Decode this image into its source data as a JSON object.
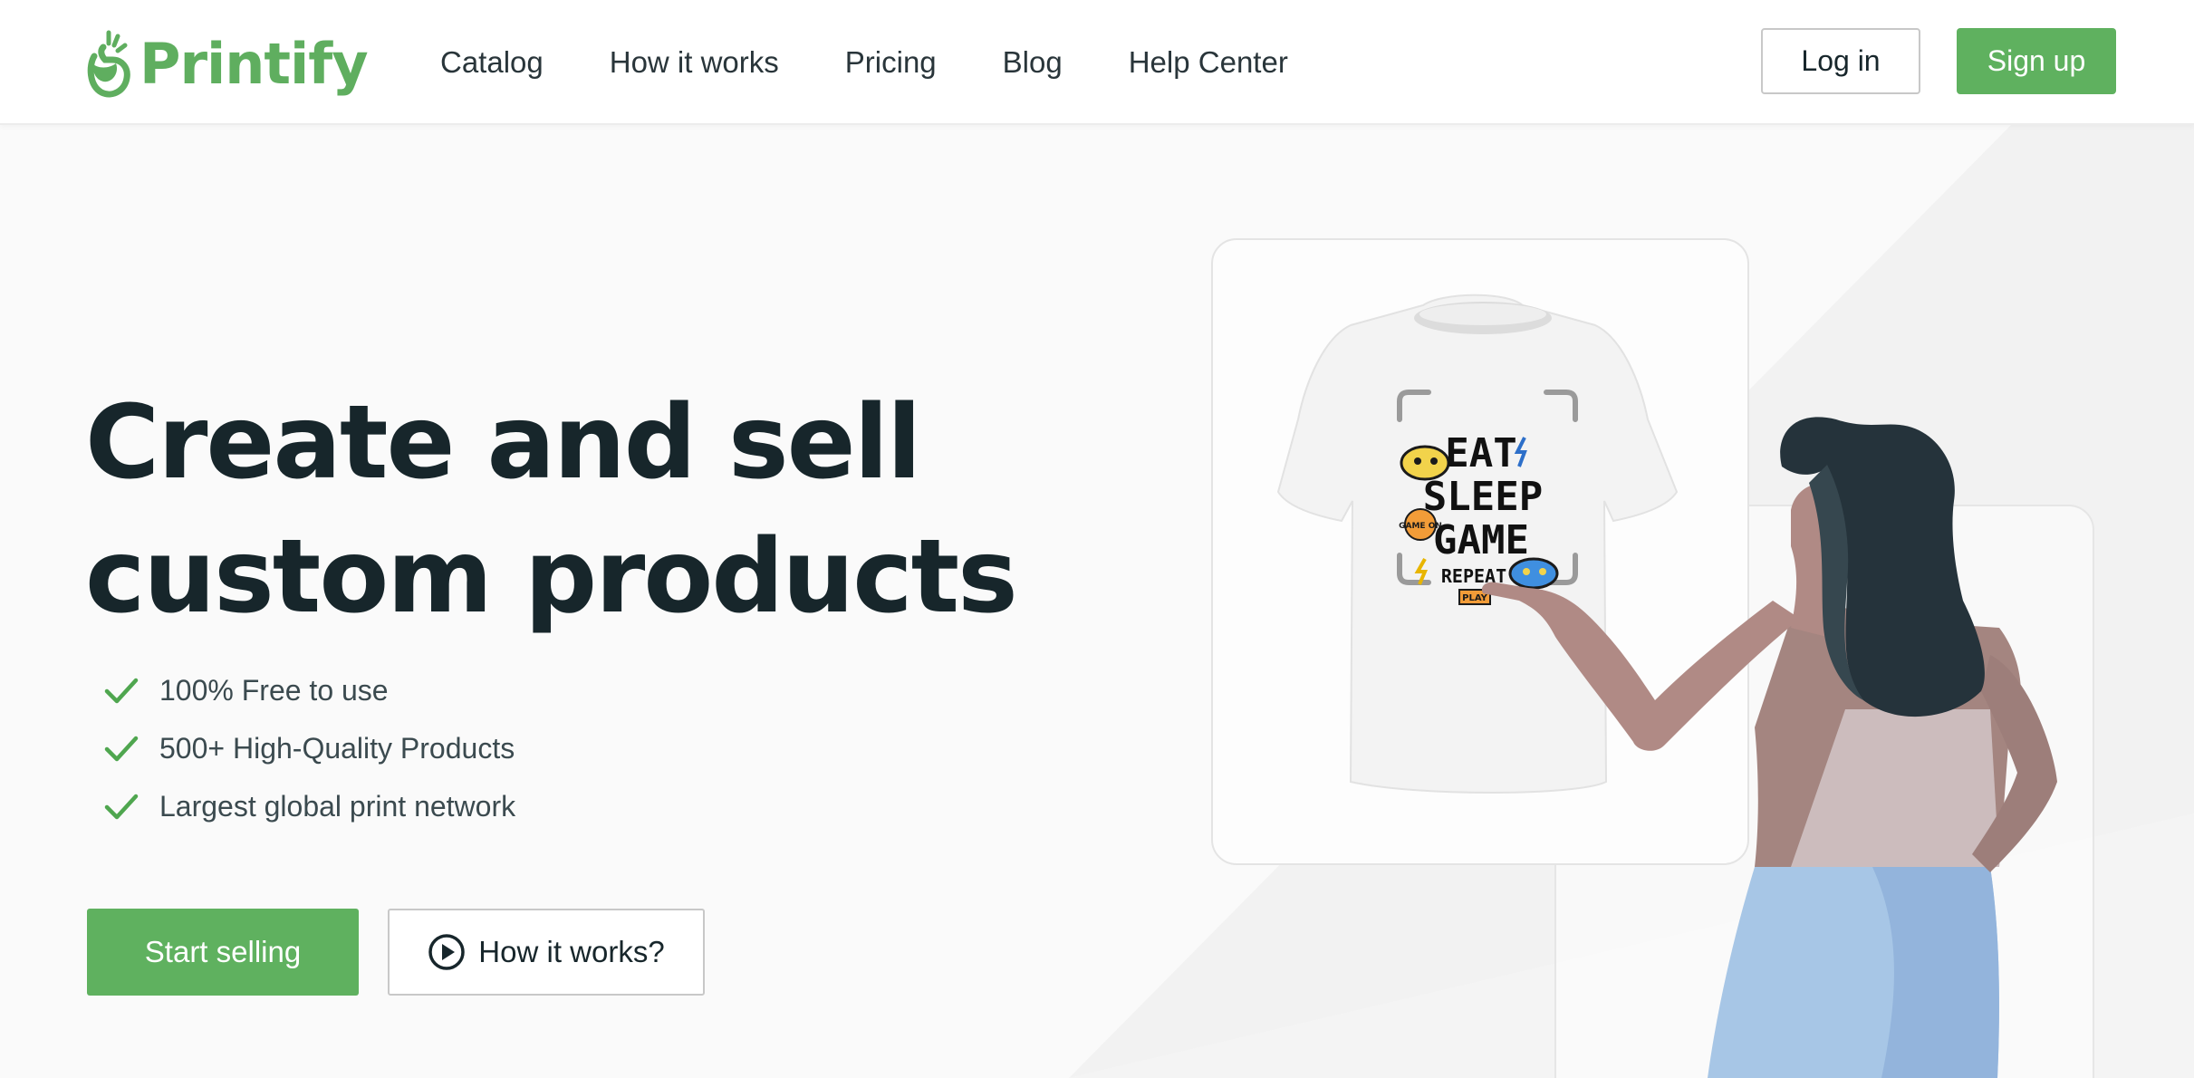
{
  "header": {
    "brand": "Printify",
    "nav": [
      "Catalog",
      "How it works",
      "Pricing",
      "Blog",
      "Help Center"
    ],
    "login_label": "Log in",
    "signup_label": "Sign up"
  },
  "hero": {
    "title_line1": "Create and sell",
    "title_line2": "custom products",
    "features": [
      "100% Free to use",
      "500+ High-Quality Products",
      "Largest global print network"
    ],
    "start_selling_label": "Start selling",
    "how_it_works_label": "How it works?"
  },
  "tshirt_print": {
    "line1": "EAT",
    "line2": "SLEEP",
    "line3": "GAME",
    "line4": "REPEAT",
    "badge_game_on": "GAME ON",
    "badge_play": "PLAY"
  },
  "colors": {
    "brand_green": "#5fb15f",
    "text_dark": "#17262b",
    "skin": "#b08a85",
    "hair": "#25333b",
    "skirt": "#a7c6e6"
  }
}
